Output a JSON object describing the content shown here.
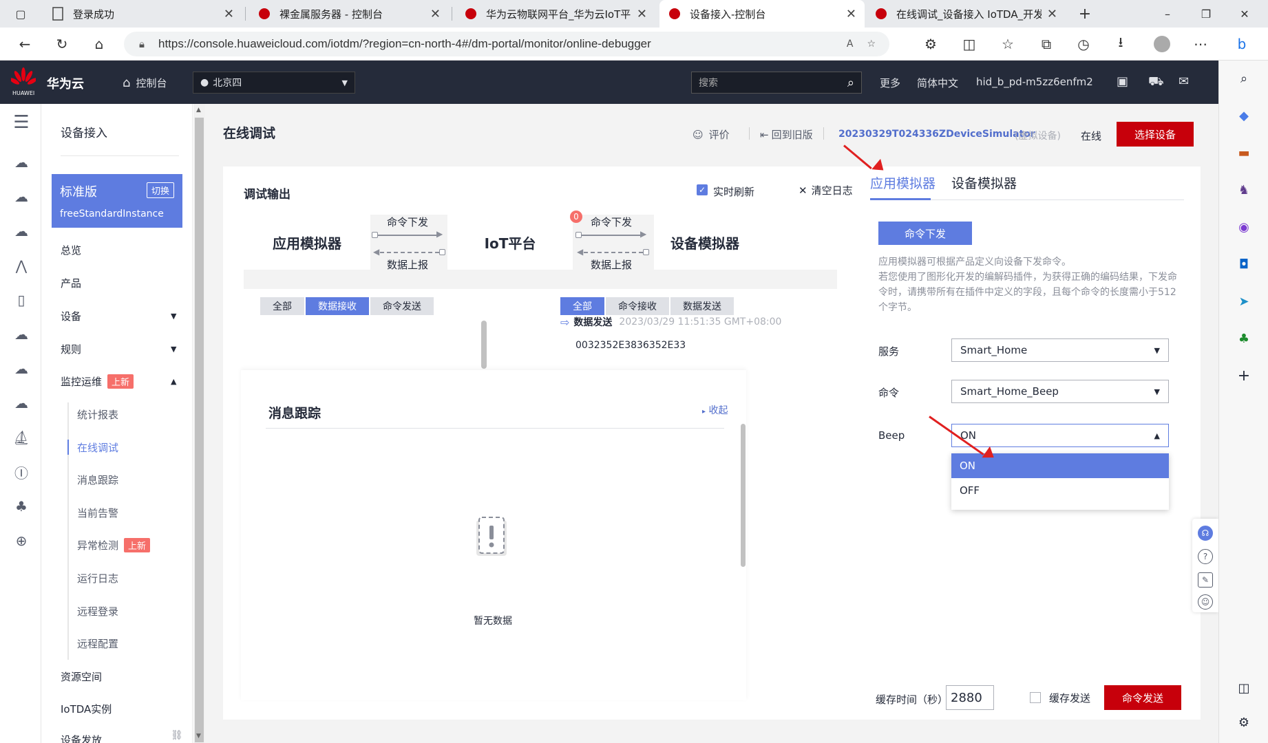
{
  "browser": {
    "tabs": [
      {
        "label": "登录成功"
      },
      {
        "label": "裸金属服务器 - 控制台"
      },
      {
        "label": "华为云物联网平台_华为云IoT平台"
      },
      {
        "label": "设备接入-控制台"
      },
      {
        "label": "在线调试_设备接入 IoTDA_开发指"
      }
    ],
    "url": "https://console.huaweicloud.com/iotdm/?region=cn-north-4#/dm-portal/monitor/online-debugger"
  },
  "header": {
    "logo_text": "HUAWEI",
    "brand": "华为云",
    "console": "控制台",
    "region": "北京四",
    "search_placeholder": "搜索",
    "more": "更多",
    "language": "简体中文",
    "user": "hid_b_pd-m5zz6enfm2"
  },
  "sidenav": {
    "title": "设备接入",
    "edition": "标准版",
    "switch": "切换",
    "instance": "freeStandardInstance",
    "items": [
      {
        "label": "总览"
      },
      {
        "label": "产品"
      },
      {
        "label": "设备"
      },
      {
        "label": "规则"
      },
      {
        "label": "监控运维",
        "badge": "上新"
      },
      {
        "label": "资源空间"
      },
      {
        "label": "IoTDA实例"
      },
      {
        "label": "设备发放"
      }
    ],
    "sub_items": [
      {
        "label": "统计报表"
      },
      {
        "label": "在线调试"
      },
      {
        "label": "消息跟踪"
      },
      {
        "label": "当前告警"
      },
      {
        "label": "异常检测",
        "badge": "上新"
      },
      {
        "label": "运行日志"
      },
      {
        "label": "远程登录"
      },
      {
        "label": "远程配置"
      }
    ]
  },
  "page": {
    "title": "在线调试",
    "rate": "评价",
    "back_old": "回到旧版",
    "device_id": "20230329T024336ZDeviceSimulator",
    "device_virtual": "(虚拟设备)",
    "device_status": "在线",
    "select_device": "选择设备"
  },
  "debug": {
    "title": "调试输出",
    "realtime": "实时刷新",
    "clear": "清空日志",
    "app_sim": "应用模拟器",
    "iot_platform": "IoT平台",
    "dev_sim": "设备模拟器",
    "cmd_down": "命令下发",
    "data_up": "数据上报",
    "badge_count": "0",
    "left_tabs": [
      "全部",
      "数据接收",
      "命令发送"
    ],
    "right_tabs": [
      "全部",
      "命令接收",
      "数据发送"
    ],
    "log": {
      "type": "数据发送",
      "time": "2023/03/29 11:51:35 GMT+08:00",
      "data": "0032352E3836352E33"
    }
  },
  "trace": {
    "title": "消息跟踪",
    "collapse": "收起",
    "empty": "暂无数据"
  },
  "simulator": {
    "tabs": [
      "应用模拟器",
      "设备模拟器"
    ],
    "cmd_button": "命令下发",
    "description": "应用模拟器可根据产品定义向设备下发命令。\n若您使用了图形化开发的编解码插件，为获得正确的编码结果，下发命令时，请携带所有在插件中定义的字段，且每个命令的长度需小于512个字节。",
    "service_label": "服务",
    "service_value": "Smart_Home",
    "command_label": "命令",
    "command_value": "Smart_Home_Beep",
    "beep_label": "Beep",
    "beep_value": "ON",
    "beep_options": [
      "ON",
      "OFF"
    ],
    "cache_label": "缓存时间（秒）",
    "cache_value": "2880",
    "cache_send": "缓存发送",
    "send": "命令发送"
  },
  "colors": {
    "accent": "#5e7ce0",
    "brand_red": "#c7000b",
    "header_bg": "#252b3a"
  }
}
